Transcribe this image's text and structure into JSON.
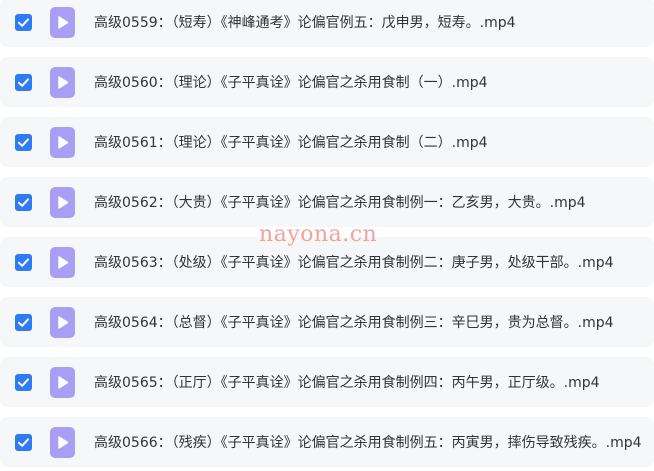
{
  "files": [
    {
      "name": "高级0559：（短寿）《神峰通考》论偏官例五：戊申男，短寿。.mp4",
      "checked": true,
      "icon": "video-file-icon"
    },
    {
      "name": "高级0560：（理论）《子平真诠》论偏官之杀用食制（一）.mp4",
      "checked": true,
      "icon": "video-file-icon"
    },
    {
      "name": "高级0561：（理论）《子平真诠》论偏官之杀用食制（二）.mp4",
      "checked": true,
      "icon": "video-file-icon"
    },
    {
      "name": "高级0562：（大贵）《子平真诠》论偏官之杀用食制例一：乙亥男，大贵。.mp4",
      "checked": true,
      "icon": "video-file-icon"
    },
    {
      "name": "高级0563：（处级）《子平真诠》论偏官之杀用食制例二：庚子男，处级干部。.mp4",
      "checked": true,
      "icon": "video-file-icon"
    },
    {
      "name": "高级0564：（总督）《子平真诠》论偏官之杀用食制例三：辛巳男，贵为总督。.mp4",
      "checked": true,
      "icon": "video-file-icon"
    },
    {
      "name": "高级0565：（正厅）《子平真诠》论偏官之杀用食制例四：丙午男，正厅级。.mp4",
      "checked": true,
      "icon": "video-file-icon"
    },
    {
      "name": "高级0566：（残疾）《子平真诠》论偏官之杀用食制例五：丙寅男，摔伤导致残疾。.mp4",
      "checked": true,
      "icon": "video-file-icon"
    }
  ],
  "watermark": "nayona.cn",
  "colors": {
    "row_bg": "#f6f7f9",
    "checkbox": "#2f7bf3",
    "file_icon": "#a89ff4",
    "watermark": "#f3a29b",
    "text": "#333333"
  }
}
